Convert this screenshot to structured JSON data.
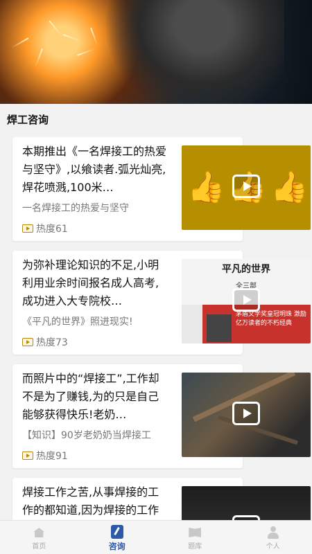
{
  "status": {
    "time": "",
    "icons": ""
  },
  "section": {
    "title": "焊工咨询"
  },
  "articles": [
    {
      "title": "本期推出《一名焊接工的热爱与坚守》,以飨读者.弧光灿亮,焊花喷溅,100米…",
      "subtitle": "一名焊接工的热爱与坚守",
      "heat": "热度61",
      "thumb": "thumbs-up"
    },
    {
      "title": "为弥补理论知识的不足,小明利用业余时间报名成人高考,成功进入大专院校…",
      "subtitle": "《平凡的世界》照进现实!",
      "heat": "热度73",
      "thumb": "book-cover",
      "book": {
        "title": "平凡的世界",
        "volume": "全三部",
        "band_text": "茅盾文学奖皇冠明珠 激励亿万读者的不朽经典"
      }
    },
    {
      "title": "而照片中的“焊接工”,工作却不是为了赚钱,为的只是自己能够获得快乐!老奶…",
      "subtitle": "【知识】90岁老奶奶当焊接工",
      "heat": "热度91",
      "thumb": "workshop"
    },
    {
      "title": "焊接工作之苦,从事焊接的工作的都知道,因为焊接的工作环境十分的恶劣,经…",
      "subtitle": "",
      "heat": "",
      "thumb": "dark"
    }
  ],
  "tabbar": {
    "items": [
      {
        "label": "首页",
        "icon": "home-icon"
      },
      {
        "label": "咨询",
        "icon": "consult-icon"
      },
      {
        "label": "题库",
        "icon": "book-icon"
      },
      {
        "label": "个人",
        "icon": "user-icon"
      }
    ]
  }
}
